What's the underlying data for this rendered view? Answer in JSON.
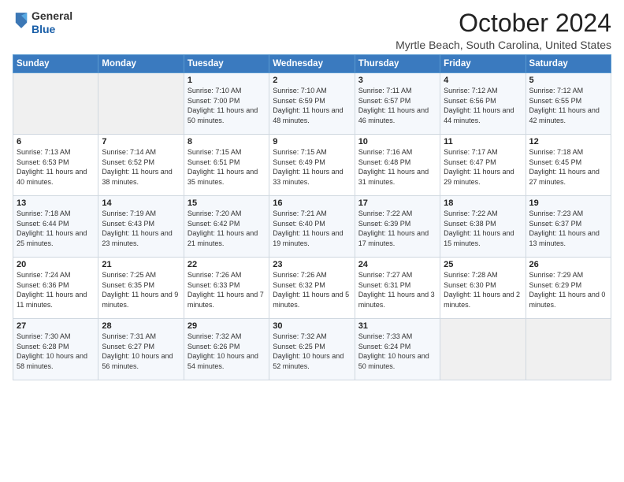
{
  "logo": {
    "general": "General",
    "blue": "Blue"
  },
  "title": "October 2024",
  "subtitle": "Myrtle Beach, South Carolina, United States",
  "days_of_week": [
    "Sunday",
    "Monday",
    "Tuesday",
    "Wednesday",
    "Thursday",
    "Friday",
    "Saturday"
  ],
  "weeks": [
    [
      {
        "day": "",
        "sunrise": "",
        "sunset": "",
        "daylight": ""
      },
      {
        "day": "",
        "sunrise": "",
        "sunset": "",
        "daylight": ""
      },
      {
        "day": "1",
        "sunrise": "Sunrise: 7:10 AM",
        "sunset": "Sunset: 7:00 PM",
        "daylight": "Daylight: 11 hours and 50 minutes."
      },
      {
        "day": "2",
        "sunrise": "Sunrise: 7:10 AM",
        "sunset": "Sunset: 6:59 PM",
        "daylight": "Daylight: 11 hours and 48 minutes."
      },
      {
        "day": "3",
        "sunrise": "Sunrise: 7:11 AM",
        "sunset": "Sunset: 6:57 PM",
        "daylight": "Daylight: 11 hours and 46 minutes."
      },
      {
        "day": "4",
        "sunrise": "Sunrise: 7:12 AM",
        "sunset": "Sunset: 6:56 PM",
        "daylight": "Daylight: 11 hours and 44 minutes."
      },
      {
        "day": "5",
        "sunrise": "Sunrise: 7:12 AM",
        "sunset": "Sunset: 6:55 PM",
        "daylight": "Daylight: 11 hours and 42 minutes."
      }
    ],
    [
      {
        "day": "6",
        "sunrise": "Sunrise: 7:13 AM",
        "sunset": "Sunset: 6:53 PM",
        "daylight": "Daylight: 11 hours and 40 minutes."
      },
      {
        "day": "7",
        "sunrise": "Sunrise: 7:14 AM",
        "sunset": "Sunset: 6:52 PM",
        "daylight": "Daylight: 11 hours and 38 minutes."
      },
      {
        "day": "8",
        "sunrise": "Sunrise: 7:15 AM",
        "sunset": "Sunset: 6:51 PM",
        "daylight": "Daylight: 11 hours and 35 minutes."
      },
      {
        "day": "9",
        "sunrise": "Sunrise: 7:15 AM",
        "sunset": "Sunset: 6:49 PM",
        "daylight": "Daylight: 11 hours and 33 minutes."
      },
      {
        "day": "10",
        "sunrise": "Sunrise: 7:16 AM",
        "sunset": "Sunset: 6:48 PM",
        "daylight": "Daylight: 11 hours and 31 minutes."
      },
      {
        "day": "11",
        "sunrise": "Sunrise: 7:17 AM",
        "sunset": "Sunset: 6:47 PM",
        "daylight": "Daylight: 11 hours and 29 minutes."
      },
      {
        "day": "12",
        "sunrise": "Sunrise: 7:18 AM",
        "sunset": "Sunset: 6:45 PM",
        "daylight": "Daylight: 11 hours and 27 minutes."
      }
    ],
    [
      {
        "day": "13",
        "sunrise": "Sunrise: 7:18 AM",
        "sunset": "Sunset: 6:44 PM",
        "daylight": "Daylight: 11 hours and 25 minutes."
      },
      {
        "day": "14",
        "sunrise": "Sunrise: 7:19 AM",
        "sunset": "Sunset: 6:43 PM",
        "daylight": "Daylight: 11 hours and 23 minutes."
      },
      {
        "day": "15",
        "sunrise": "Sunrise: 7:20 AM",
        "sunset": "Sunset: 6:42 PM",
        "daylight": "Daylight: 11 hours and 21 minutes."
      },
      {
        "day": "16",
        "sunrise": "Sunrise: 7:21 AM",
        "sunset": "Sunset: 6:40 PM",
        "daylight": "Daylight: 11 hours and 19 minutes."
      },
      {
        "day": "17",
        "sunrise": "Sunrise: 7:22 AM",
        "sunset": "Sunset: 6:39 PM",
        "daylight": "Daylight: 11 hours and 17 minutes."
      },
      {
        "day": "18",
        "sunrise": "Sunrise: 7:22 AM",
        "sunset": "Sunset: 6:38 PM",
        "daylight": "Daylight: 11 hours and 15 minutes."
      },
      {
        "day": "19",
        "sunrise": "Sunrise: 7:23 AM",
        "sunset": "Sunset: 6:37 PM",
        "daylight": "Daylight: 11 hours and 13 minutes."
      }
    ],
    [
      {
        "day": "20",
        "sunrise": "Sunrise: 7:24 AM",
        "sunset": "Sunset: 6:36 PM",
        "daylight": "Daylight: 11 hours and 11 minutes."
      },
      {
        "day": "21",
        "sunrise": "Sunrise: 7:25 AM",
        "sunset": "Sunset: 6:35 PM",
        "daylight": "Daylight: 11 hours and 9 minutes."
      },
      {
        "day": "22",
        "sunrise": "Sunrise: 7:26 AM",
        "sunset": "Sunset: 6:33 PM",
        "daylight": "Daylight: 11 hours and 7 minutes."
      },
      {
        "day": "23",
        "sunrise": "Sunrise: 7:26 AM",
        "sunset": "Sunset: 6:32 PM",
        "daylight": "Daylight: 11 hours and 5 minutes."
      },
      {
        "day": "24",
        "sunrise": "Sunrise: 7:27 AM",
        "sunset": "Sunset: 6:31 PM",
        "daylight": "Daylight: 11 hours and 3 minutes."
      },
      {
        "day": "25",
        "sunrise": "Sunrise: 7:28 AM",
        "sunset": "Sunset: 6:30 PM",
        "daylight": "Daylight: 11 hours and 2 minutes."
      },
      {
        "day": "26",
        "sunrise": "Sunrise: 7:29 AM",
        "sunset": "Sunset: 6:29 PM",
        "daylight": "Daylight: 11 hours and 0 minutes."
      }
    ],
    [
      {
        "day": "27",
        "sunrise": "Sunrise: 7:30 AM",
        "sunset": "Sunset: 6:28 PM",
        "daylight": "Daylight: 10 hours and 58 minutes."
      },
      {
        "day": "28",
        "sunrise": "Sunrise: 7:31 AM",
        "sunset": "Sunset: 6:27 PM",
        "daylight": "Daylight: 10 hours and 56 minutes."
      },
      {
        "day": "29",
        "sunrise": "Sunrise: 7:32 AM",
        "sunset": "Sunset: 6:26 PM",
        "daylight": "Daylight: 10 hours and 54 minutes."
      },
      {
        "day": "30",
        "sunrise": "Sunrise: 7:32 AM",
        "sunset": "Sunset: 6:25 PM",
        "daylight": "Daylight: 10 hours and 52 minutes."
      },
      {
        "day": "31",
        "sunrise": "Sunrise: 7:33 AM",
        "sunset": "Sunset: 6:24 PM",
        "daylight": "Daylight: 10 hours and 50 minutes."
      },
      {
        "day": "",
        "sunrise": "",
        "sunset": "",
        "daylight": ""
      },
      {
        "day": "",
        "sunrise": "",
        "sunset": "",
        "daylight": ""
      }
    ]
  ]
}
